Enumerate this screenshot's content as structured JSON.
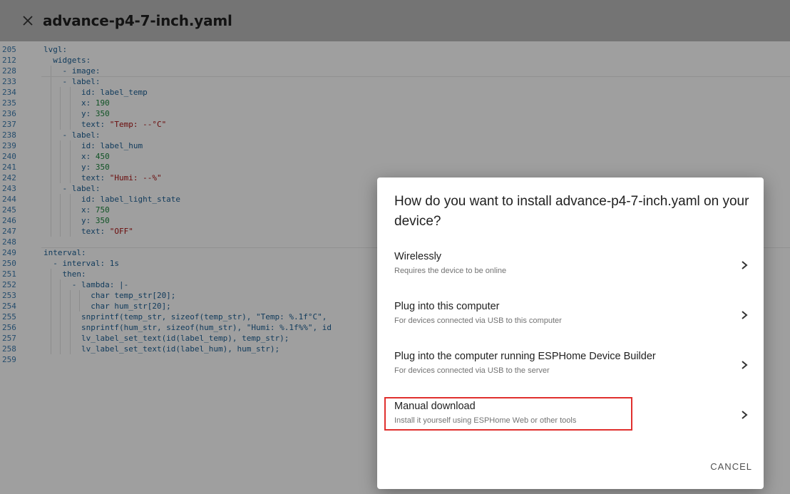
{
  "header": {
    "title": "advance-p4-7-inch.yaml"
  },
  "editor": {
    "lines": [
      {
        "n": "205",
        "text": "lvgl:"
      },
      {
        "n": "212",
        "text": "  widgets:"
      },
      {
        "n": "228",
        "text": "    - image:"
      },
      {
        "n": "233",
        "text": "    - label:"
      },
      {
        "n": "234",
        "text": "        id: label_temp"
      },
      {
        "n": "235",
        "text": "        x: 190"
      },
      {
        "n": "236",
        "text": "        y: 350"
      },
      {
        "n": "237",
        "text": "        text: \"Temp: --°C\""
      },
      {
        "n": "238",
        "text": "    - label:"
      },
      {
        "n": "239",
        "text": "        id: label_hum"
      },
      {
        "n": "240",
        "text": "        x: 450"
      },
      {
        "n": "241",
        "text": "        y: 350"
      },
      {
        "n": "242",
        "text": "        text: \"Humi: --%\""
      },
      {
        "n": "243",
        "text": "    - label:"
      },
      {
        "n": "244",
        "text": "        id: label_light_state"
      },
      {
        "n": "245",
        "text": "        x: 750"
      },
      {
        "n": "246",
        "text": "        y: 350"
      },
      {
        "n": "247",
        "text": "        text: \"OFF\""
      },
      {
        "n": "248",
        "text": ""
      },
      {
        "n": "249",
        "text": "interval:"
      },
      {
        "n": "250",
        "text": "  - interval: 1s"
      },
      {
        "n": "251",
        "text": "    then:"
      },
      {
        "n": "252",
        "text": "      - lambda: |-"
      },
      {
        "n": "253",
        "text": "          char temp_str[20];"
      },
      {
        "n": "254",
        "text": "          char hum_str[20];"
      },
      {
        "n": "255",
        "text": "        snprintf(temp_str, sizeof(temp_str), \"Temp: %.1f°C\","
      },
      {
        "n": "256",
        "text": "        snprintf(hum_str, sizeof(hum_str), \"Humi: %.1f%%\", id"
      },
      {
        "n": "257",
        "text": "        lv_label_set_text(id(label_temp), temp_str);"
      },
      {
        "n": "258",
        "text": "        lv_label_set_text(id(label_hum), hum_str);"
      },
      {
        "n": "259",
        "text": ""
      }
    ]
  },
  "dialog": {
    "title": "How do you want to install advance-p4-7-inch.yaml on your device?",
    "options": [
      {
        "title": "Wirelessly",
        "subtitle": "Requires the device to be online"
      },
      {
        "title": "Plug into this computer",
        "subtitle": "For devices connected via USB to this computer"
      },
      {
        "title": "Plug into the computer running ESPHome Device Builder",
        "subtitle": "For devices connected via USB to the server"
      },
      {
        "title": "Manual download",
        "subtitle": "Install it yourself using ESPHome Web or other tools"
      }
    ],
    "cancel_label": "CANCEL"
  },
  "colors": {
    "highlight": "#e0302e",
    "header_bg": "#b0b0b0"
  },
  "icons": {
    "close": "close-icon",
    "chevron": "chevron-right-icon"
  }
}
